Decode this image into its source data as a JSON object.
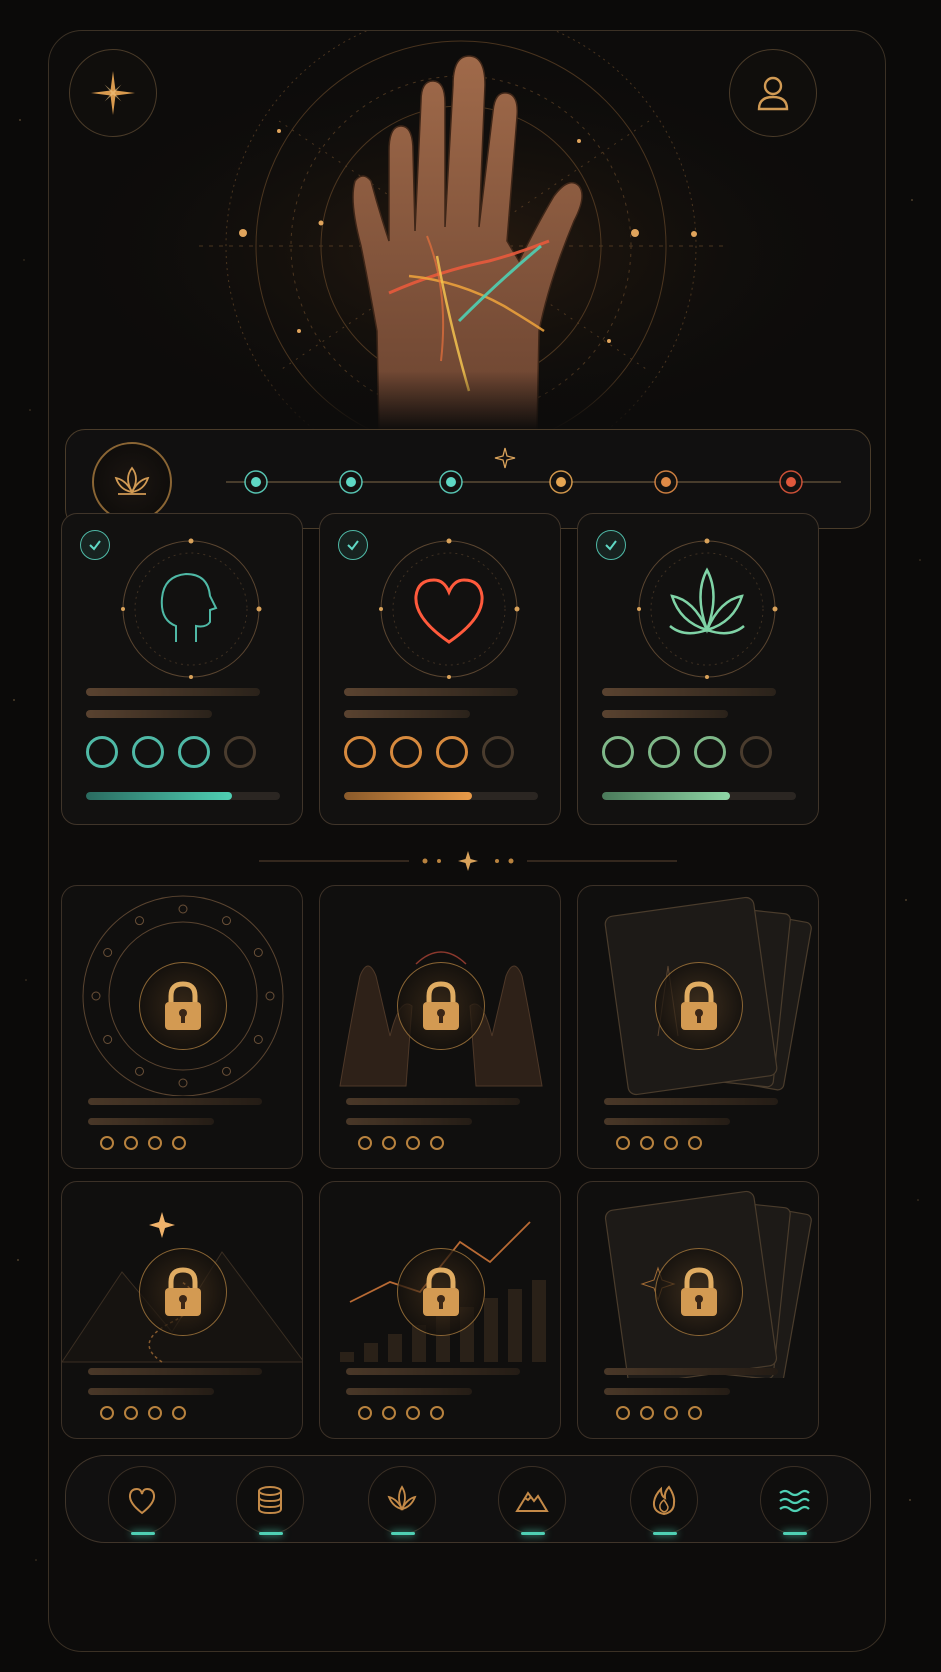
{
  "app": {
    "background": "#0b0a09",
    "accent_gold": "#d19a54",
    "accent_teal": "#4fd0b4"
  },
  "header": {
    "left_button_icon": "sparkle-star-icon",
    "right_button_icon": "user-icon",
    "hero_image": "palm-hand-with-glowing-lines"
  },
  "journey": {
    "badge_icon": "lotus-icon",
    "nodes": [
      {
        "color": "#5fd8c4"
      },
      {
        "color": "#5fd8c4"
      },
      {
        "color": "#5fd8c4"
      },
      {
        "color": "#e5a552"
      },
      {
        "color": "#e08a46"
      },
      {
        "color": "#e0583c"
      }
    ]
  },
  "completed_cards": [
    {
      "icon": "head-profile-icon",
      "accent": "#4fb9a6",
      "completed": true,
      "rating_filled": 3,
      "rating_total": 4,
      "progress": 0.75
    },
    {
      "icon": "heart-icon",
      "accent": "#d78a3e",
      "completed": true,
      "rating_filled": 3,
      "rating_total": 4,
      "progress": 0.66
    },
    {
      "icon": "lotus-icon",
      "accent": "#7fb889",
      "completed": true,
      "rating_filled": 3,
      "rating_total": 4,
      "progress": 0.66
    }
  ],
  "locked_cards": [
    {
      "icon": "lock-icon",
      "artwork": "zodiac-wheel",
      "rating_total": 4
    },
    {
      "icon": "lock-icon",
      "artwork": "two-hands",
      "rating_total": 4
    },
    {
      "icon": "lock-icon",
      "artwork": "tarot-cards",
      "rating_total": 4
    },
    {
      "icon": "lock-icon",
      "artwork": "mountain-path-star",
      "rating_total": 4
    },
    {
      "icon": "lock-icon",
      "artwork": "rising-chart",
      "rating_total": 4
    },
    {
      "icon": "lock-icon",
      "artwork": "tarot-cards-star",
      "rating_total": 4
    }
  ],
  "bottom_nav": [
    {
      "icon": "heart-icon"
    },
    {
      "icon": "coins-stack-icon"
    },
    {
      "icon": "lotus-icon"
    },
    {
      "icon": "mountain-icon"
    },
    {
      "icon": "flame-icon"
    },
    {
      "icon": "waves-icon"
    }
  ]
}
